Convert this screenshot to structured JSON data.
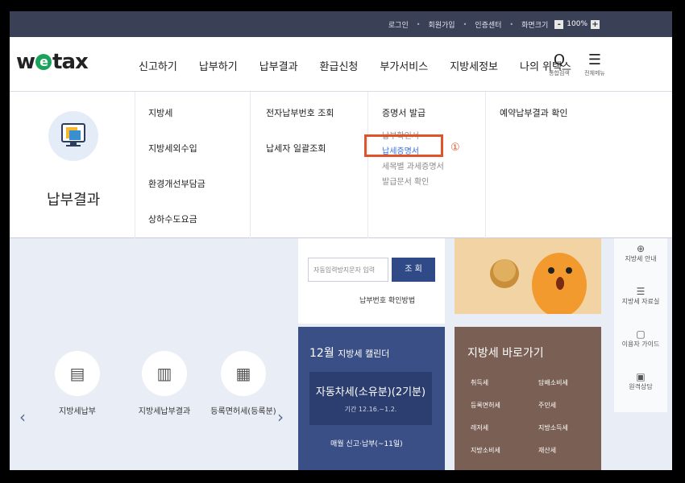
{
  "topbar": {
    "login": "로그인",
    "join": "회원가입",
    "cert": "인증센터",
    "zoom_label": "화면크기",
    "zoom_minus": "-",
    "zoom_value": "100%",
    "zoom_plus": "+"
  },
  "logo": {
    "w": "w",
    "e": "e",
    "rest": "tax"
  },
  "gnb": [
    "신고하기",
    "납부하기",
    "납부결과",
    "환급신청",
    "부가서비스",
    "지방세정보",
    "나의 위택스"
  ],
  "header_icons": [
    {
      "glyph": "Q",
      "label": "통합검색",
      "icon": "search-icon"
    },
    {
      "glyph": "☰",
      "label": "전체메뉴",
      "icon": "menu-icon"
    }
  ],
  "mega": {
    "title": "납부결과",
    "col1": [
      "지방세",
      "지방세외수입",
      "환경개선부담금",
      "상하수도요금"
    ],
    "col2": [
      "전자납부번호 조회",
      "납세자 일괄조회"
    ],
    "col3_head": "증명서 발급",
    "col3_subs": [
      "납부확인서",
      "납세증명서",
      "세목별 과세증명서",
      "발급문서 확인"
    ],
    "col4": [
      "예약납부결과 확인"
    ],
    "annotation": "①"
  },
  "lookup": {
    "placeholder": "자동입력방지문자 입력",
    "button": "조 회",
    "help": "납부번호 확인방법"
  },
  "calendar": {
    "month": "12월",
    "title": "지방세 캘린더",
    "main_tax": "자동차세(소유분)(2기분)",
    "period": "기간 12.16.~1.2.",
    "monthly": "매월 신고·납부(~11일)"
  },
  "quick": {
    "title": "지방세 바로가기",
    "items": [
      "취득세",
      "담배소비세",
      "등록면허세",
      "주민세",
      "레저세",
      "지방소득세",
      "지방소비세",
      "재산세"
    ]
  },
  "side": [
    {
      "glyph": "⊕",
      "label": "지방세 안내"
    },
    {
      "glyph": "☰",
      "label": "지방세 자료실"
    },
    {
      "glyph": "▢",
      "label": "이용자 가이드"
    },
    {
      "glyph": "▣",
      "label": "원격상담"
    }
  ],
  "services": [
    {
      "glyph": "▤",
      "label": "지방세납부"
    },
    {
      "glyph": "▥",
      "label": "지방세납부결과"
    },
    {
      "glyph": "▦",
      "label": "등록면허세(등록분)"
    }
  ],
  "arrows": {
    "prev": "‹",
    "next": "›"
  }
}
